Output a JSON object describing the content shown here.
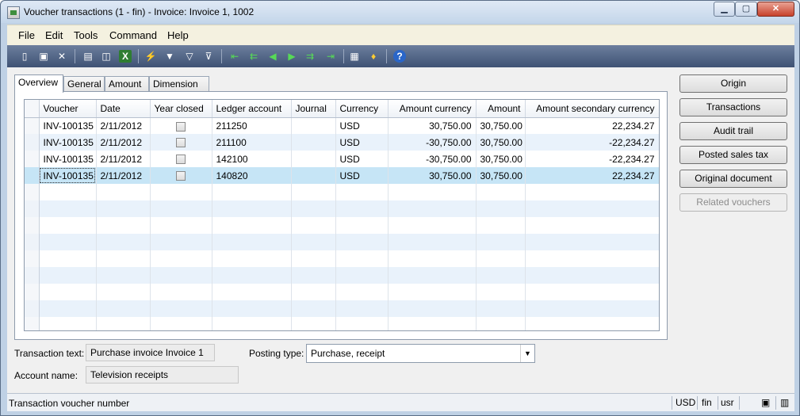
{
  "window": {
    "title": "Voucher transactions (1 - fin) - Invoice: Invoice 1, 1002",
    "min_glyph": "▁",
    "max_glyph": "▢",
    "close_glyph": "✕"
  },
  "menu": [
    "File",
    "Edit",
    "Tools",
    "Command",
    "Help"
  ],
  "toolbar_icons": {
    "new": "▯",
    "save": "▣",
    "delete": "✕",
    "print": "▤",
    "preview": "◫",
    "excel": "X",
    "filter_selection": "⚡",
    "filter_by_grid": "▼",
    "advanced_filter": "▽",
    "remove_filter": "⊽",
    "first": "⇤",
    "page_up": "⇇",
    "previous": "◀",
    "next": "▶",
    "page_down": "⇉",
    "last": "⇥",
    "attachments": "▦",
    "alert": "♦",
    "help": "?"
  },
  "tabs": [
    "Overview",
    "General",
    "Amount",
    "Dimension"
  ],
  "grid": {
    "columns": [
      "Voucher",
      "Date",
      "Year closed",
      "Ledger account",
      "Journal",
      "Currency",
      "Amount currency",
      "Amount",
      "Amount secondary currency"
    ],
    "rows": [
      {
        "voucher": "INV-100135",
        "date": "2/11/2012",
        "ledger": "211250",
        "journal": "",
        "currency": "USD",
        "amount_currency": "30,750.00",
        "amount": "30,750.00",
        "amount_secondary": "22,234.27"
      },
      {
        "voucher": "INV-100135",
        "date": "2/11/2012",
        "ledger": "211100",
        "journal": "",
        "currency": "USD",
        "amount_currency": "-30,750.00",
        "amount": "30,750.00",
        "amount_secondary": "-22,234.27"
      },
      {
        "voucher": "INV-100135",
        "date": "2/11/2012",
        "ledger": "142100",
        "journal": "",
        "currency": "USD",
        "amount_currency": "-30,750.00",
        "amount": "30,750.00",
        "amount_secondary": "-22,234.27"
      },
      {
        "voucher": "INV-100135",
        "date": "2/11/2012",
        "ledger": "140820",
        "journal": "",
        "currency": "USD",
        "amount_currency": "30,750.00",
        "amount": "30,750.00",
        "amount_secondary": "22,234.27"
      }
    ]
  },
  "buttons": {
    "origin": "Origin",
    "transactions": "Transactions",
    "audit_trail": "Audit trail",
    "posted_sales_tax": "Posted sales tax",
    "original_document": "Original document",
    "related_vouchers": "Related vouchers"
  },
  "fields": {
    "transaction_text_label": "Transaction text:",
    "transaction_text_value": "Purchase invoice Invoice 1",
    "account_name_label": "Account name:",
    "account_name_value": "Television receipts",
    "posting_type_label": "Posting type:",
    "posting_type_value": "Purchase, receipt"
  },
  "status": {
    "text": "Transaction voucher number",
    "currency": "USD",
    "company": "fin",
    "layer": "usr",
    "icon1": "▣",
    "icon2": "▥"
  }
}
